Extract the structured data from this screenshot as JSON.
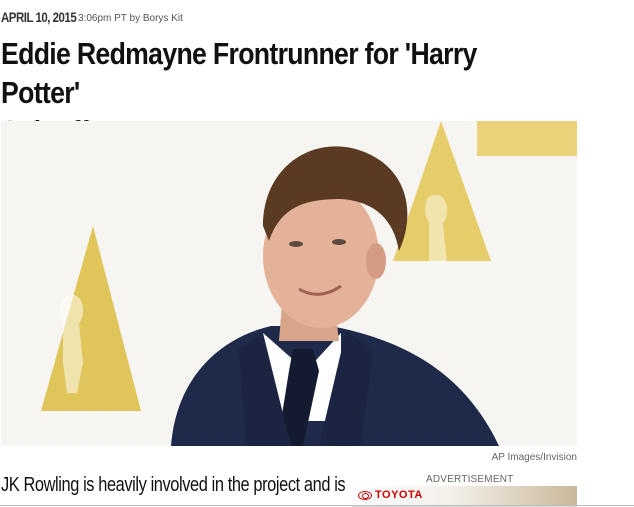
{
  "article": {
    "date": "APRIL 10, 2015",
    "time_byline": "3:06pm PT by Borys Kit",
    "headline_line1": "Eddie Redmayne Frontrunner for 'Harry Potter'",
    "headline_line2": "Spinoff",
    "photo_credit": "AP Images/Invision",
    "teaser": "JK Rowling is heavily involved in the project and is"
  },
  "ad": {
    "label": "ADVERTISEMENT",
    "brand": "TOYOTA"
  },
  "colors": {
    "background": "#ffffff",
    "text": "#111111",
    "muted": "#666666",
    "brand_red": "#cc0000"
  }
}
